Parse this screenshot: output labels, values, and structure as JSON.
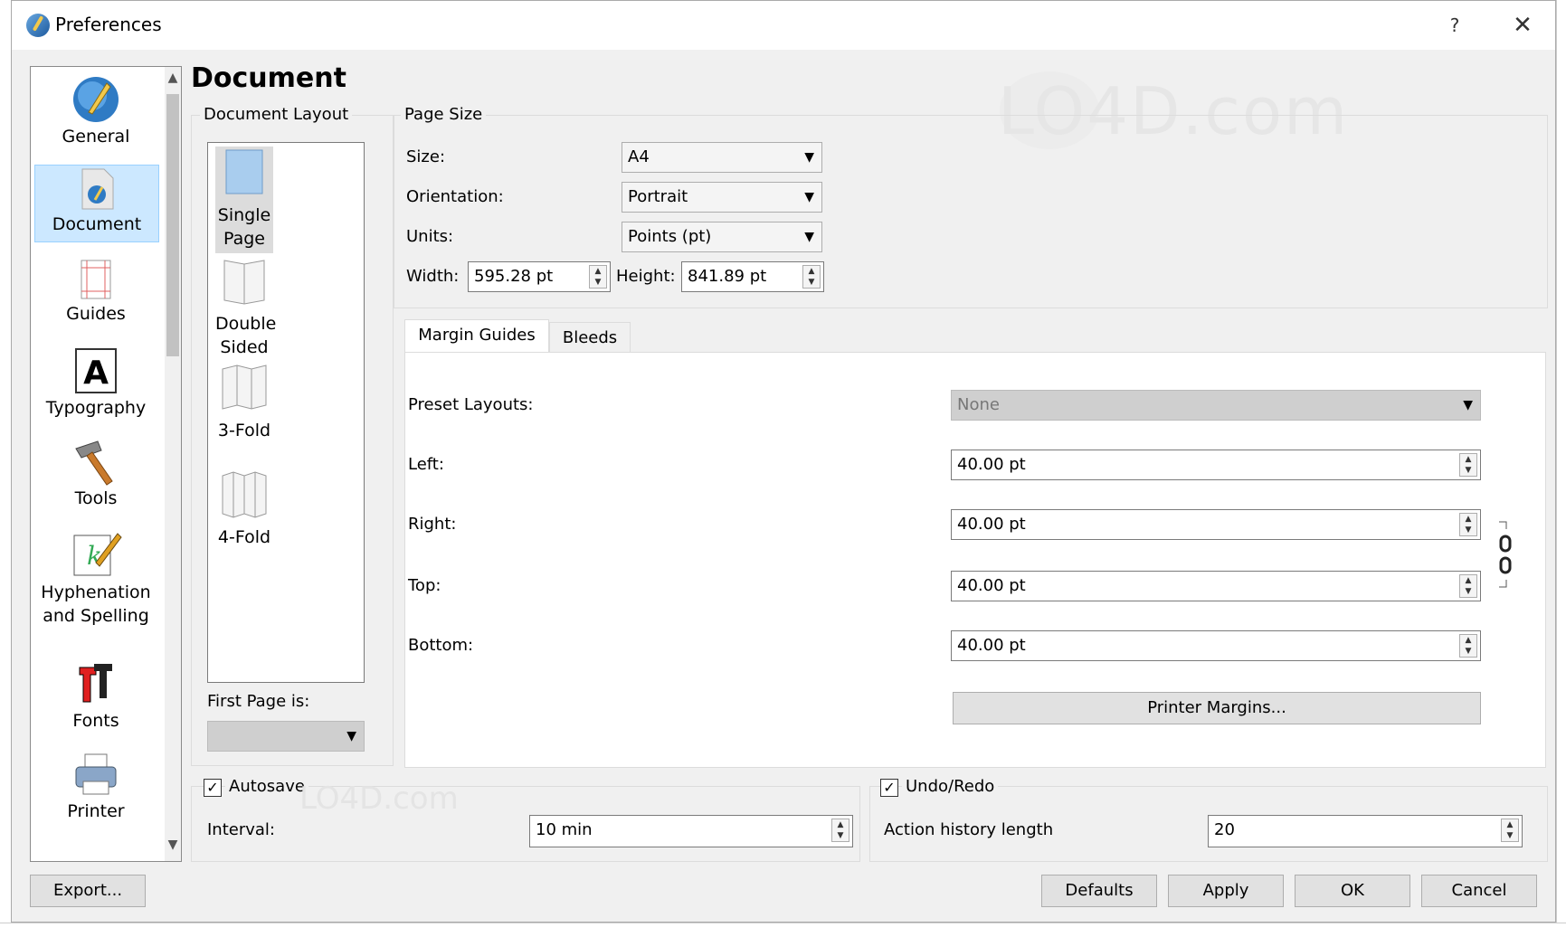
{
  "window": {
    "title": "Preferences",
    "help": "?",
    "close": "✕"
  },
  "sidebar": {
    "items": [
      {
        "label": "General",
        "icon": "general-quill-icon"
      },
      {
        "label": "Document",
        "icon": "document-icon",
        "selected": true
      },
      {
        "label": "Guides",
        "icon": "guides-icon"
      },
      {
        "label": "Typography",
        "icon": "typography-icon"
      },
      {
        "label": "Tools",
        "icon": "hammer-icon"
      },
      {
        "label": "Hyphenation and Spelling",
        "icon": "hyphenation-pen-icon"
      },
      {
        "label": "Fonts",
        "icon": "fonts-icon"
      },
      {
        "label": "Printer",
        "icon": "printer-icon"
      }
    ]
  },
  "main": {
    "heading": "Document",
    "document_layout": {
      "title": "Document Layout",
      "options": [
        "Single Page",
        "Double Sided",
        "3-Fold",
        "4-Fold"
      ],
      "selected": "Single Page",
      "first_page_label": "First Page is:",
      "first_page_value": ""
    },
    "page_size": {
      "title": "Page Size",
      "size_label": "Size:",
      "size_value": "A4",
      "orientation_label": "Orientation:",
      "orientation_value": "Portrait",
      "units_label": "Units:",
      "units_value": "Points (pt)",
      "width_label": "Width:",
      "width_value": "595.28 pt",
      "height_label": "Height:",
      "height_value": "841.89 pt"
    },
    "tabs": [
      {
        "label": "Margin Guides",
        "active": true
      },
      {
        "label": "Bleeds",
        "active": false
      }
    ],
    "margins": {
      "preset_label": "Preset Layouts:",
      "preset_value": "None",
      "left_label": "Left:",
      "left_value": "40.00 pt",
      "right_label": "Right:",
      "right_value": "40.00 pt",
      "top_label": "Top:",
      "top_value": "40.00 pt",
      "bottom_label": "Bottom:",
      "bottom_value": "40.00 pt",
      "printer_margins": "Printer Margins..."
    },
    "autosave": {
      "label": "Autosave",
      "checked": true,
      "interval_label": "Interval:",
      "interval_value": "10 min"
    },
    "undo": {
      "label": "Undo/Redo",
      "checked": true,
      "history_label": "Action history length",
      "history_value": "20"
    }
  },
  "footer": {
    "export": "Export...",
    "defaults": "Defaults",
    "apply": "Apply",
    "ok": "OK",
    "cancel": "Cancel"
  },
  "watermark": "LO4D.com",
  "colors": {
    "selection": "#cce8ff",
    "window_bg": "#f0f0f0",
    "button_bg": "#e1e1e1"
  }
}
